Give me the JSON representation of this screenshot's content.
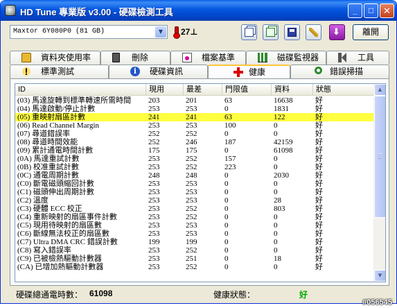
{
  "window": {
    "title": "HD Tune 專業版 v3.00 - 硬碟檢測工具"
  },
  "toolbar": {
    "drive": "Maxtor 6Y080P0 (81 GB)",
    "temperature": "27",
    "temperature_unit": "⊥",
    "exit_label": "離開"
  },
  "tabs_row1": [
    {
      "label": "資料夾使用率",
      "icon": "folder-icon"
    },
    {
      "label": "刪除",
      "icon": "trash-icon"
    },
    {
      "label": "檔案基準",
      "icon": "file-benchmark-icon"
    },
    {
      "label": "磁碟監視器",
      "icon": "disk-monitor-chart-icon"
    },
    {
      "label": "工具",
      "icon": "speaker-icon"
    }
  ],
  "tabs_row2": [
    {
      "label": "標準測試",
      "icon": "exclamation-icon"
    },
    {
      "label": "硬碟資訊",
      "icon": "info-icon"
    },
    {
      "label": "健康",
      "icon": "red-cross-icon",
      "active": true
    },
    {
      "label": "錯誤掃描",
      "icon": "magnifier-icon"
    }
  ],
  "table": {
    "headers": [
      "ID",
      "現用",
      "最差",
      "門限值",
      "資料",
      "狀態"
    ],
    "rows": [
      [
        "(03) 馬達旋轉到標準轉速所需時間",
        "203",
        "201",
        "63",
        "16638",
        "好"
      ],
      [
        "(04) 馬達啟動/停止計數",
        "253",
        "253",
        "0",
        "1831",
        "好"
      ],
      [
        "(05) 重映射扇區計數",
        "241",
        "241",
        "63",
        "122",
        "好"
      ],
      [
        "(06) Read Channel Margin",
        "253",
        "253",
        "100",
        "0",
        "好"
      ],
      [
        "(07) 尋道錯誤率",
        "252",
        "252",
        "0",
        "0",
        "好"
      ],
      [
        "(08) 尋道時間效能",
        "252",
        "246",
        "187",
        "42159",
        "好"
      ],
      [
        "(09) 累計通電時間計數",
        "175",
        "175",
        "0",
        "61098",
        "好"
      ],
      [
        "(0A) 馬達重試計數",
        "253",
        "252",
        "157",
        "0",
        "好"
      ],
      [
        "(0B) 校准重試計數",
        "253",
        "252",
        "223",
        "0",
        "好"
      ],
      [
        "(0C) 通電周期計數",
        "248",
        "248",
        "0",
        "2030",
        "好"
      ],
      [
        "(C0) 斷電磁頭縮回計數",
        "253",
        "253",
        "0",
        "0",
        "好"
      ],
      [
        "(C1) 磁頭伸出周期計數",
        "253",
        "253",
        "0",
        "0",
        "好"
      ],
      [
        "(C2) 溫度",
        "253",
        "253",
        "0",
        "28",
        "好"
      ],
      [
        "(C3) 硬體 ECC 校正",
        "253",
        "252",
        "0",
        "803",
        "好"
      ],
      [
        "(C4) 重新映射的扇區事件計數",
        "253",
        "252",
        "0",
        "0",
        "好"
      ],
      [
        "(C5) 現用待映射的扇區數",
        "253",
        "253",
        "0",
        "0",
        "好"
      ],
      [
        "(C6) 斷線無法校正的扇區數",
        "253",
        "253",
        "0",
        "0",
        "好"
      ],
      [
        "(C7) Ultra DMA CRC 錯誤計數",
        "199",
        "199",
        "0",
        "0",
        "好"
      ],
      [
        "(C8) 寫入錯誤率",
        "253",
        "252",
        "0",
        "0",
        "好"
      ],
      [
        "(C9) 已被檢熱驅動計數器",
        "253",
        "251",
        "0",
        "18",
        "好"
      ],
      [
        "(CA) 已增加熱驅動計數器",
        "253",
        "252",
        "0",
        "0",
        "好"
      ]
    ],
    "highlighted_row": 2,
    "highlight_color": "#ffff40"
  },
  "status": {
    "power_on_label": "硬碟總通電時數：",
    "power_on_value": "61098",
    "health_label": "健康狀態：",
    "health_value": "好",
    "health_color": "#00aa00"
  },
  "watermark": "#056545"
}
